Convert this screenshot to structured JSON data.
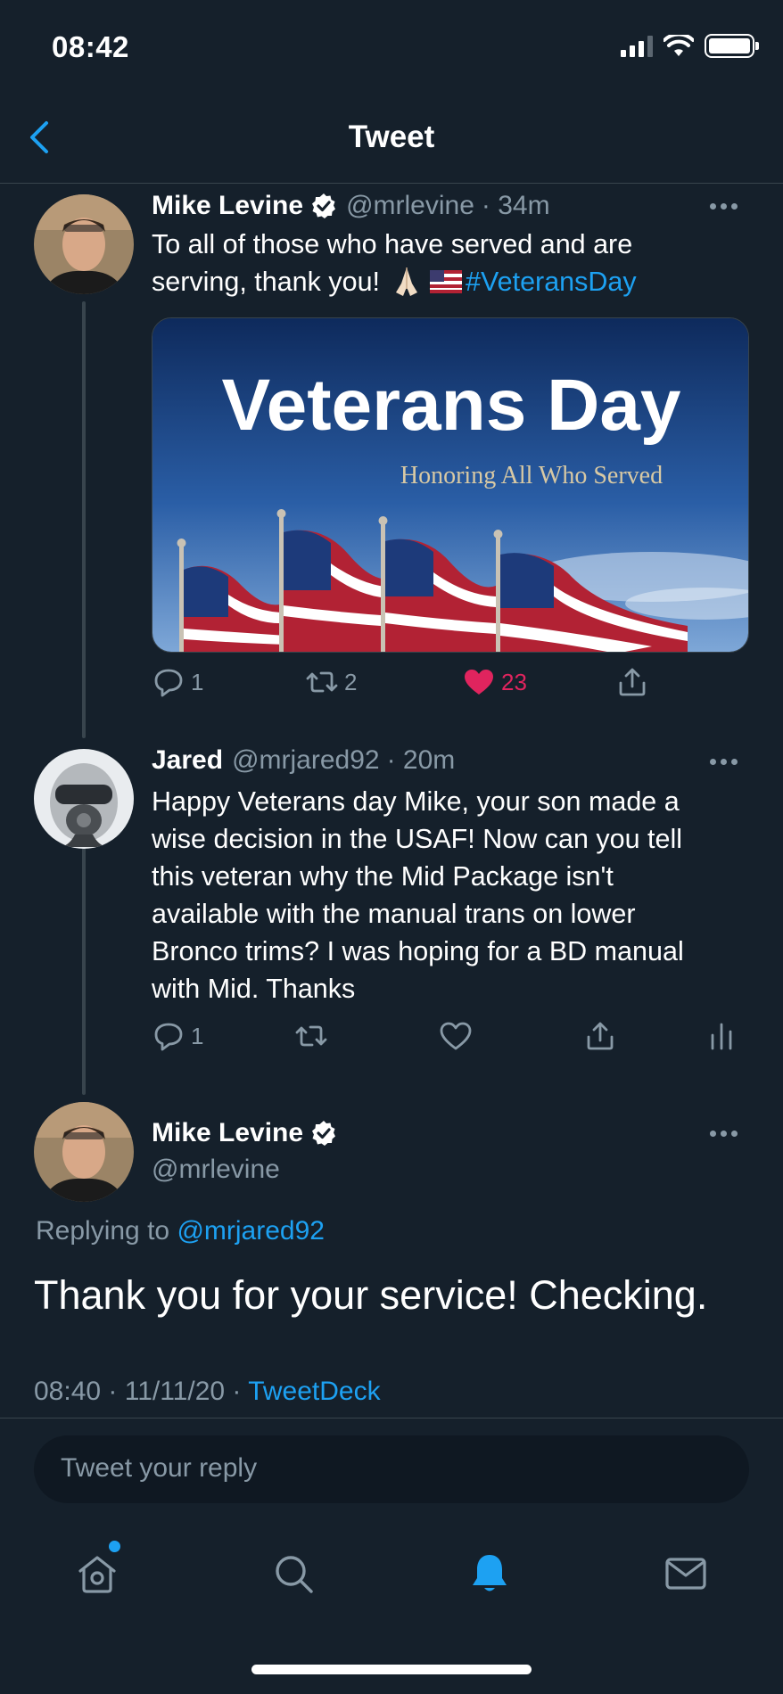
{
  "status_bar": {
    "time": "08:42"
  },
  "nav": {
    "title": "Tweet"
  },
  "tweets": [
    {
      "name": "Mike Levine",
      "handle": "@mrlevine",
      "time": "· 34m",
      "text_line1": "To all of those who have served and are",
      "text_line2": "serving, thank you!",
      "hashtag": "#VeteransDay",
      "media": {
        "title": "Veterans Day",
        "subtitle": "Honoring All Who Served"
      },
      "reply_count": "1",
      "retweet_count": "2",
      "like_count": "23"
    },
    {
      "name": "Jared",
      "handle": "@mrjared92",
      "time": "· 20m",
      "text_lines": [
        "Happy Veterans day Mike, your son made a",
        "wise decision in the USAF! Now can you tell",
        "this veteran why the Mid Package isn't",
        "available with the manual trans on lower",
        "Bronco trims? I was hoping for a BD manual",
        "with Mid. Thanks"
      ],
      "reply_count": "1"
    }
  ],
  "focus_tweet": {
    "name": "Mike Levine",
    "handle": "@mrlevine",
    "replying_label": "Replying to",
    "replying_handle": "@mrjared92",
    "text": "Thank you for your service! Checking.",
    "timestamp": "08:40 · 11/11/20 ·",
    "source": "TweetDeck"
  },
  "reply_box": {
    "placeholder": "Tweet your reply"
  },
  "colors": {
    "background": "#15202b",
    "accent": "#1da1f2",
    "muted": "#8899a6",
    "like": "#e0245e"
  },
  "icons": [
    "back-chevron-icon",
    "verified-icon",
    "more-icon",
    "reply-icon",
    "retweet-icon",
    "like-icon",
    "share-icon",
    "analytics-icon",
    "home-icon",
    "search-icon",
    "notifications-icon",
    "messages-icon"
  ]
}
